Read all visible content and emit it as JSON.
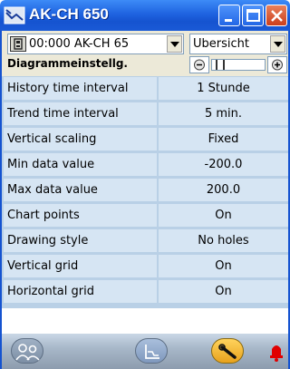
{
  "window": {
    "title": "AK-CH 650"
  },
  "toolbar": {
    "device_select": "00:000 AK-CH 65",
    "view_select": "Übersicht",
    "section_heading": "Diagrammeinstellg."
  },
  "settings": [
    {
      "label": "History time interval",
      "value": "1 Stunde"
    },
    {
      "label": "Trend time interval",
      "value": "5 min."
    },
    {
      "label": "Vertical scaling",
      "value": "Fixed"
    },
    {
      "label": "Min data value",
      "value": "-200.0"
    },
    {
      "label": "Max data value",
      "value": "200.0"
    },
    {
      "label": "Chart points",
      "value": "On"
    },
    {
      "label": "Drawing style",
      "value": "No holes"
    },
    {
      "label": "Vertical grid",
      "value": "On"
    },
    {
      "label": "Horizontal grid",
      "value": "On"
    }
  ],
  "bottom_bar": {
    "icons": [
      "people-icon",
      "chart-icon",
      "wrench-icon",
      "alarm-icon"
    ]
  },
  "colors": {
    "titlebar": "#1f63e0",
    "row_background": "#d6e5f3",
    "grid_line": "#b9d0e6",
    "close_button": "#cc3e1c",
    "wrench_button": "#e8a21d",
    "alarm": "#e00000"
  }
}
